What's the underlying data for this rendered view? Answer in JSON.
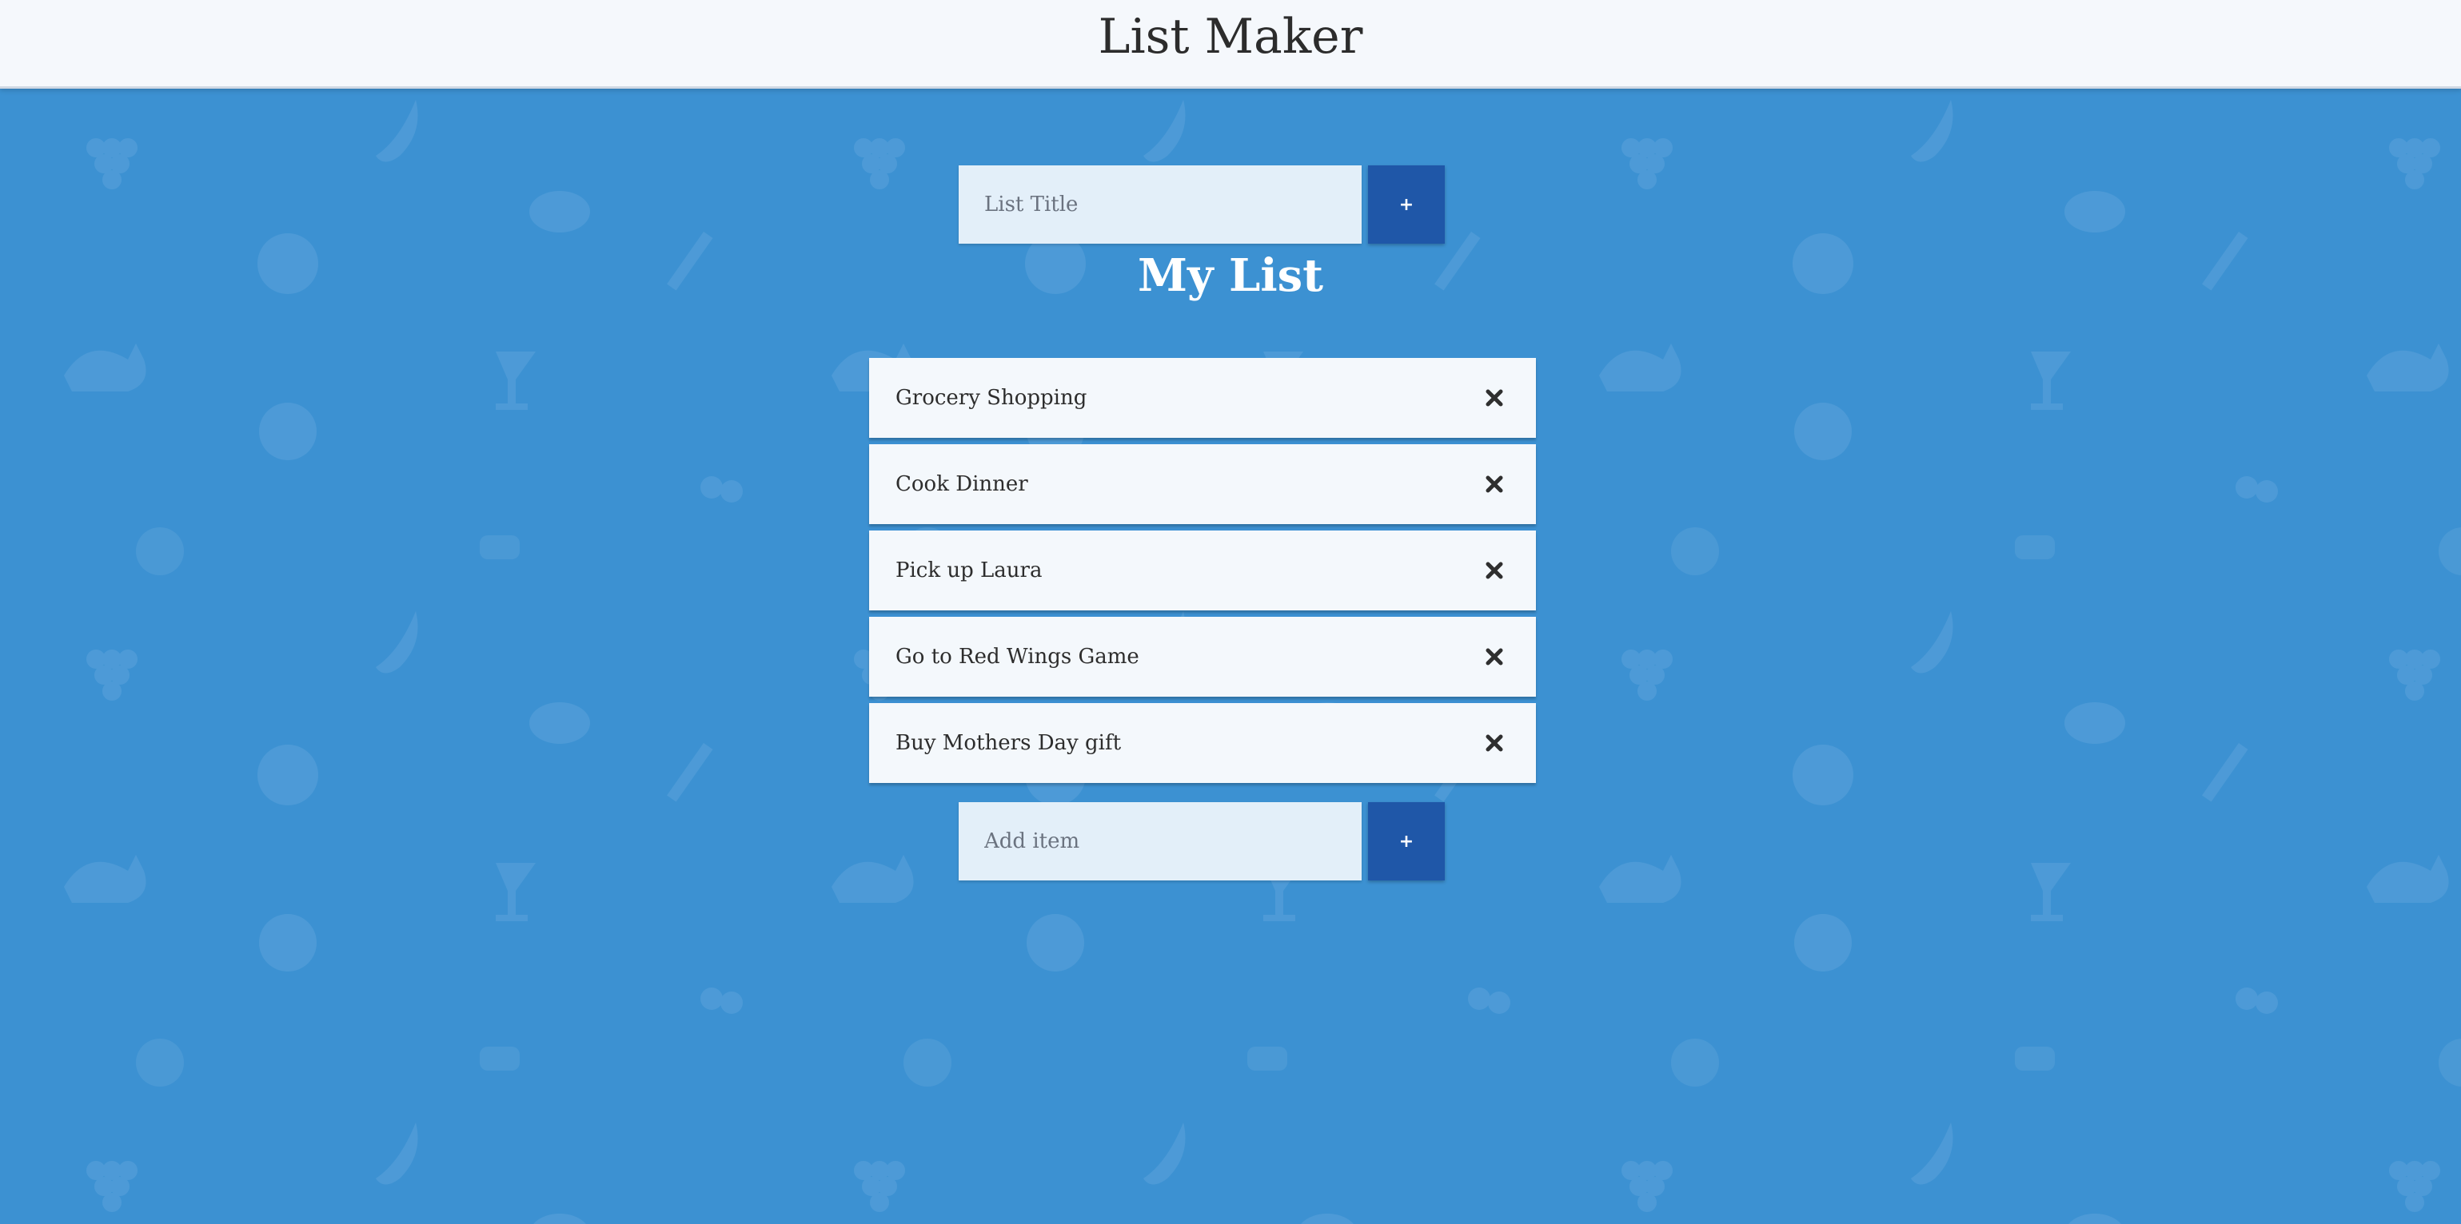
{
  "header": {
    "title": "List Maker"
  },
  "title_form": {
    "placeholder": "List Title",
    "add_label": "+"
  },
  "list": {
    "title": "My List",
    "items": [
      {
        "label": "Grocery Shopping"
      },
      {
        "label": "Cook Dinner"
      },
      {
        "label": "Pick up Laura"
      },
      {
        "label": "Go to Red Wings Game"
      },
      {
        "label": "Buy Mothers Day gift"
      }
    ],
    "delete_icon": "close-x-icon"
  },
  "item_form": {
    "placeholder": "Add item",
    "add_label": "+"
  },
  "colors": {
    "background": "#3c91d2",
    "header_bg": "#f5f8fc",
    "button": "#1f57a8",
    "input_bg": "#e3eff9",
    "item_bg": "#f4f8fc"
  }
}
